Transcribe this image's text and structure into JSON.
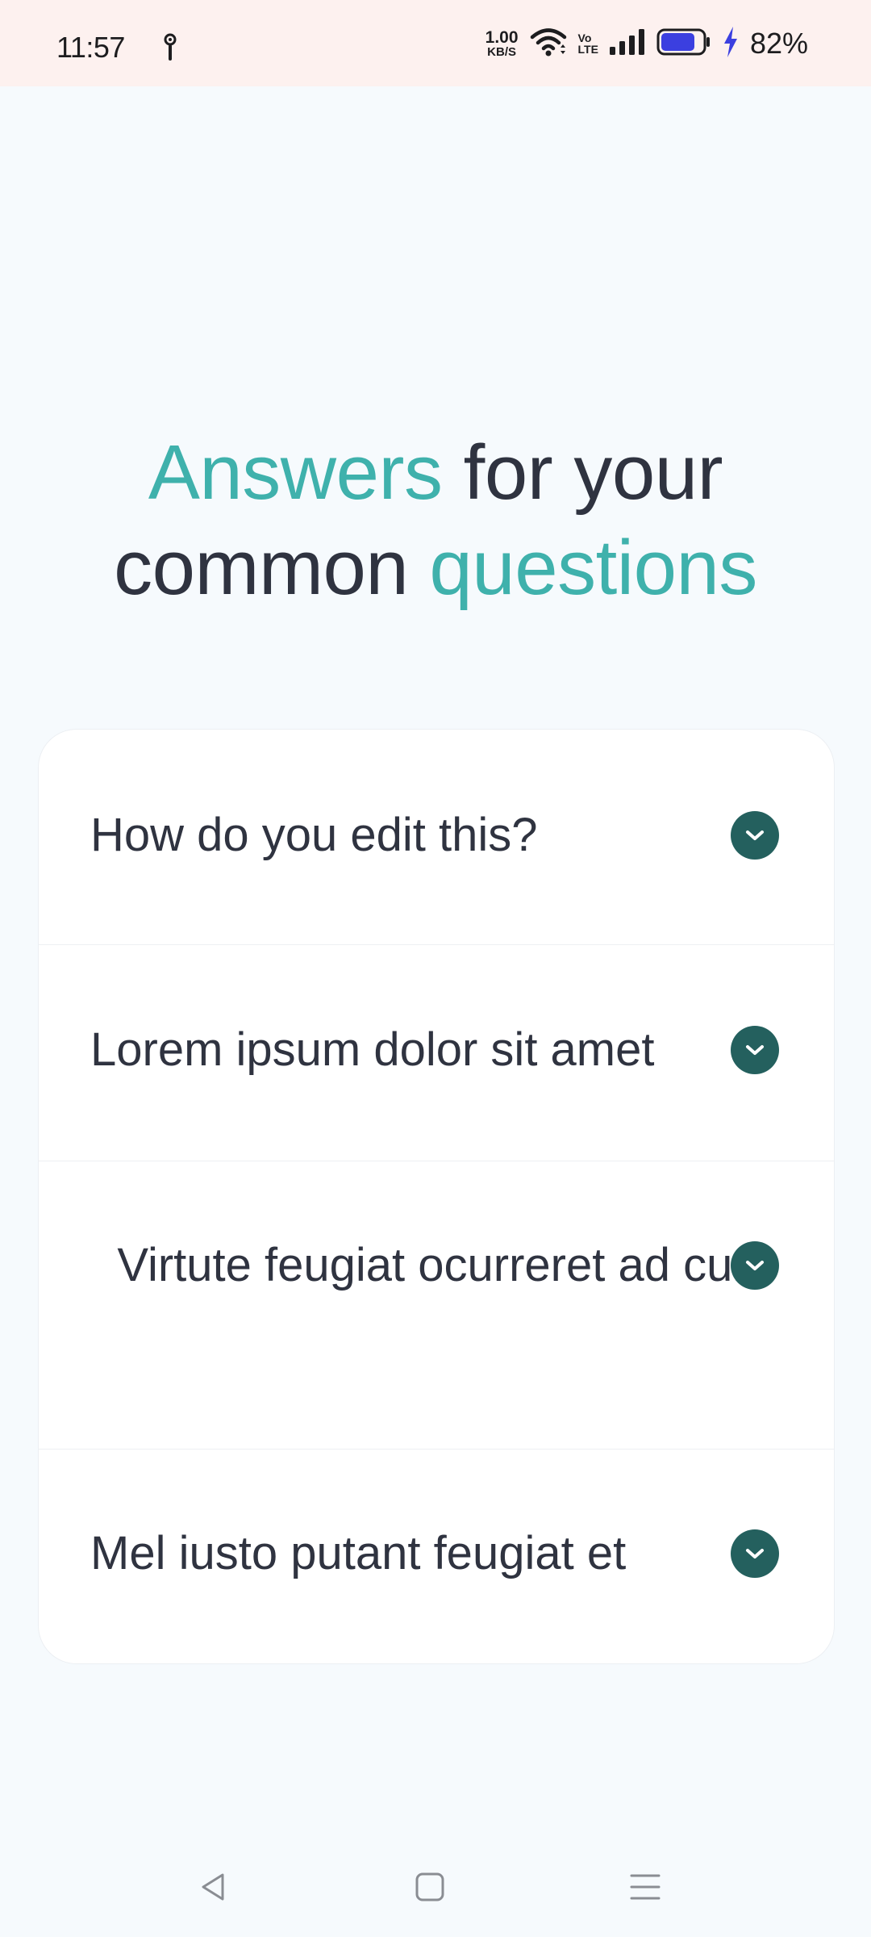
{
  "status_bar": {
    "time": "11:57",
    "net_speed_value": "1.00",
    "net_speed_unit": "KB/S",
    "volte_top": "Vo",
    "volte_bottom": "LTE",
    "battery_percent": "82%",
    "battery_level": 0.82,
    "icons": [
      "hotspot-icon",
      "wifi-icon",
      "volte-icon",
      "signal-icon",
      "battery-icon",
      "charging-icon"
    ]
  },
  "headline": {
    "word1": "Answers",
    "word2": " for your",
    "word3": "common ",
    "word4": "questions"
  },
  "faq": {
    "items": [
      {
        "question": "How do you edit this?"
      },
      {
        "question": "Lorem ipsum dolor sit amet"
      },
      {
        "question": "Virtute feugiat ocurreret ad cum"
      },
      {
        "question": "Mel iusto putant feugiat et"
      }
    ]
  },
  "colors": {
    "accent": "#3fb1ac",
    "heading": "#2f3340",
    "chevron_bg": "#24605e",
    "status_bar_bg": "#fdf1ef",
    "page_bg": "#f6fafd",
    "battery_fill": "#3b3fe0"
  },
  "nav": {
    "icons": [
      "back-icon",
      "home-icon",
      "recents-icon"
    ]
  }
}
